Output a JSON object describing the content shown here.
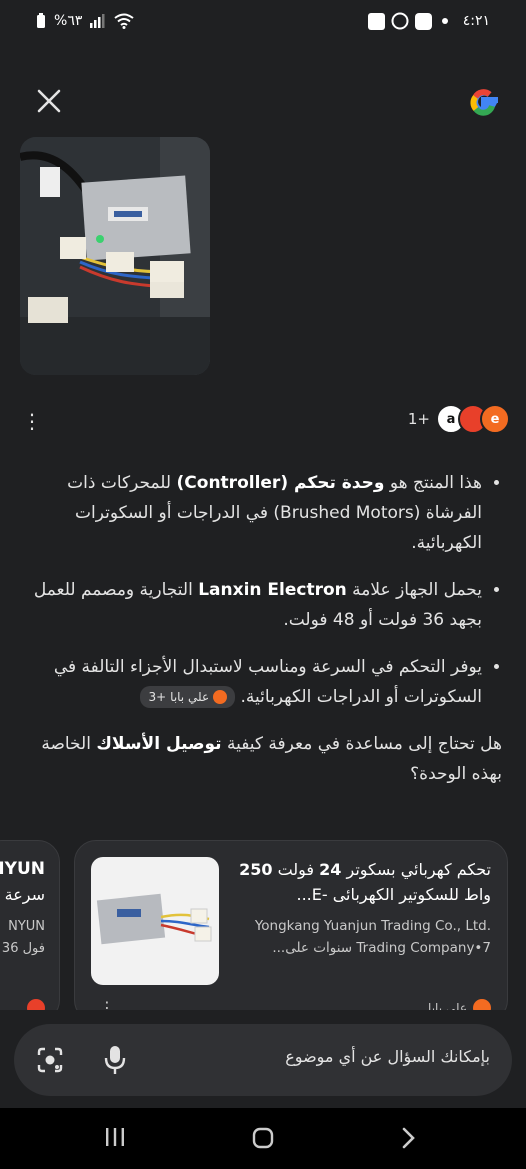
{
  "status_bar": {
    "time": "٤:٢١",
    "battery": "%٦٣"
  },
  "icons": {
    "close": "close-icon",
    "google": "google-logo",
    "lens": "lens-icon",
    "mic": "mic-icon"
  },
  "sources": {
    "count": "1+"
  },
  "answer": {
    "b1_pre": "هذا المنتج هو ",
    "b1_bold1": "وحدة تحكم (Controller)",
    "b1_post": " للمحركات ذات الفرشاة (Brushed Motors) في الدراجات أو السكوترات الكهربائية.",
    "b2_pre": "يحمل الجهاز علامة ",
    "b2_bold": "Lanxin Electron",
    "b2_post": " التجارية ومصمم للعمل بجهد 36 فولت أو 48 فولت.",
    "b3_text": "يوفر التحكم في السرعة ومناسب لاستبدال الأجزاء التالفة في السكوترات أو الدراجات الكهربائية.",
    "b3_chip_label": "علي بابا",
    "b3_chip_more": "+3",
    "q_pre": "هل تحتاج إلى مساعدة في معرفة كيفية ",
    "q_bold": "توصيل الأسلاك",
    "q_post": " الخاصة بهذه الوحدة؟"
  },
  "card1": {
    "title_pre": "تحكم كهربائي بسكوتر ",
    "title_b1": "24",
    "title_mid": " فولت ",
    "title_b2": "250",
    "title_post": " واط للسكوتير الكهربائى -E...",
    "seller": "Yongkang Yuanjun Trading Co., Ltd.",
    "meta": "Trading Company•7 سنوات على...",
    "source": "علي بابا"
  },
  "card2": {
    "t1": "NYUN",
    "t2": "سرعة",
    "t3": "NYUN",
    "t4": "36 فول"
  },
  "search": {
    "placeholder": "بإمكانك السؤال عن أي موضوع"
  },
  "colors": {
    "background": "#1f2022",
    "card": "#2b2c2f",
    "alibaba": "#f36b21"
  }
}
